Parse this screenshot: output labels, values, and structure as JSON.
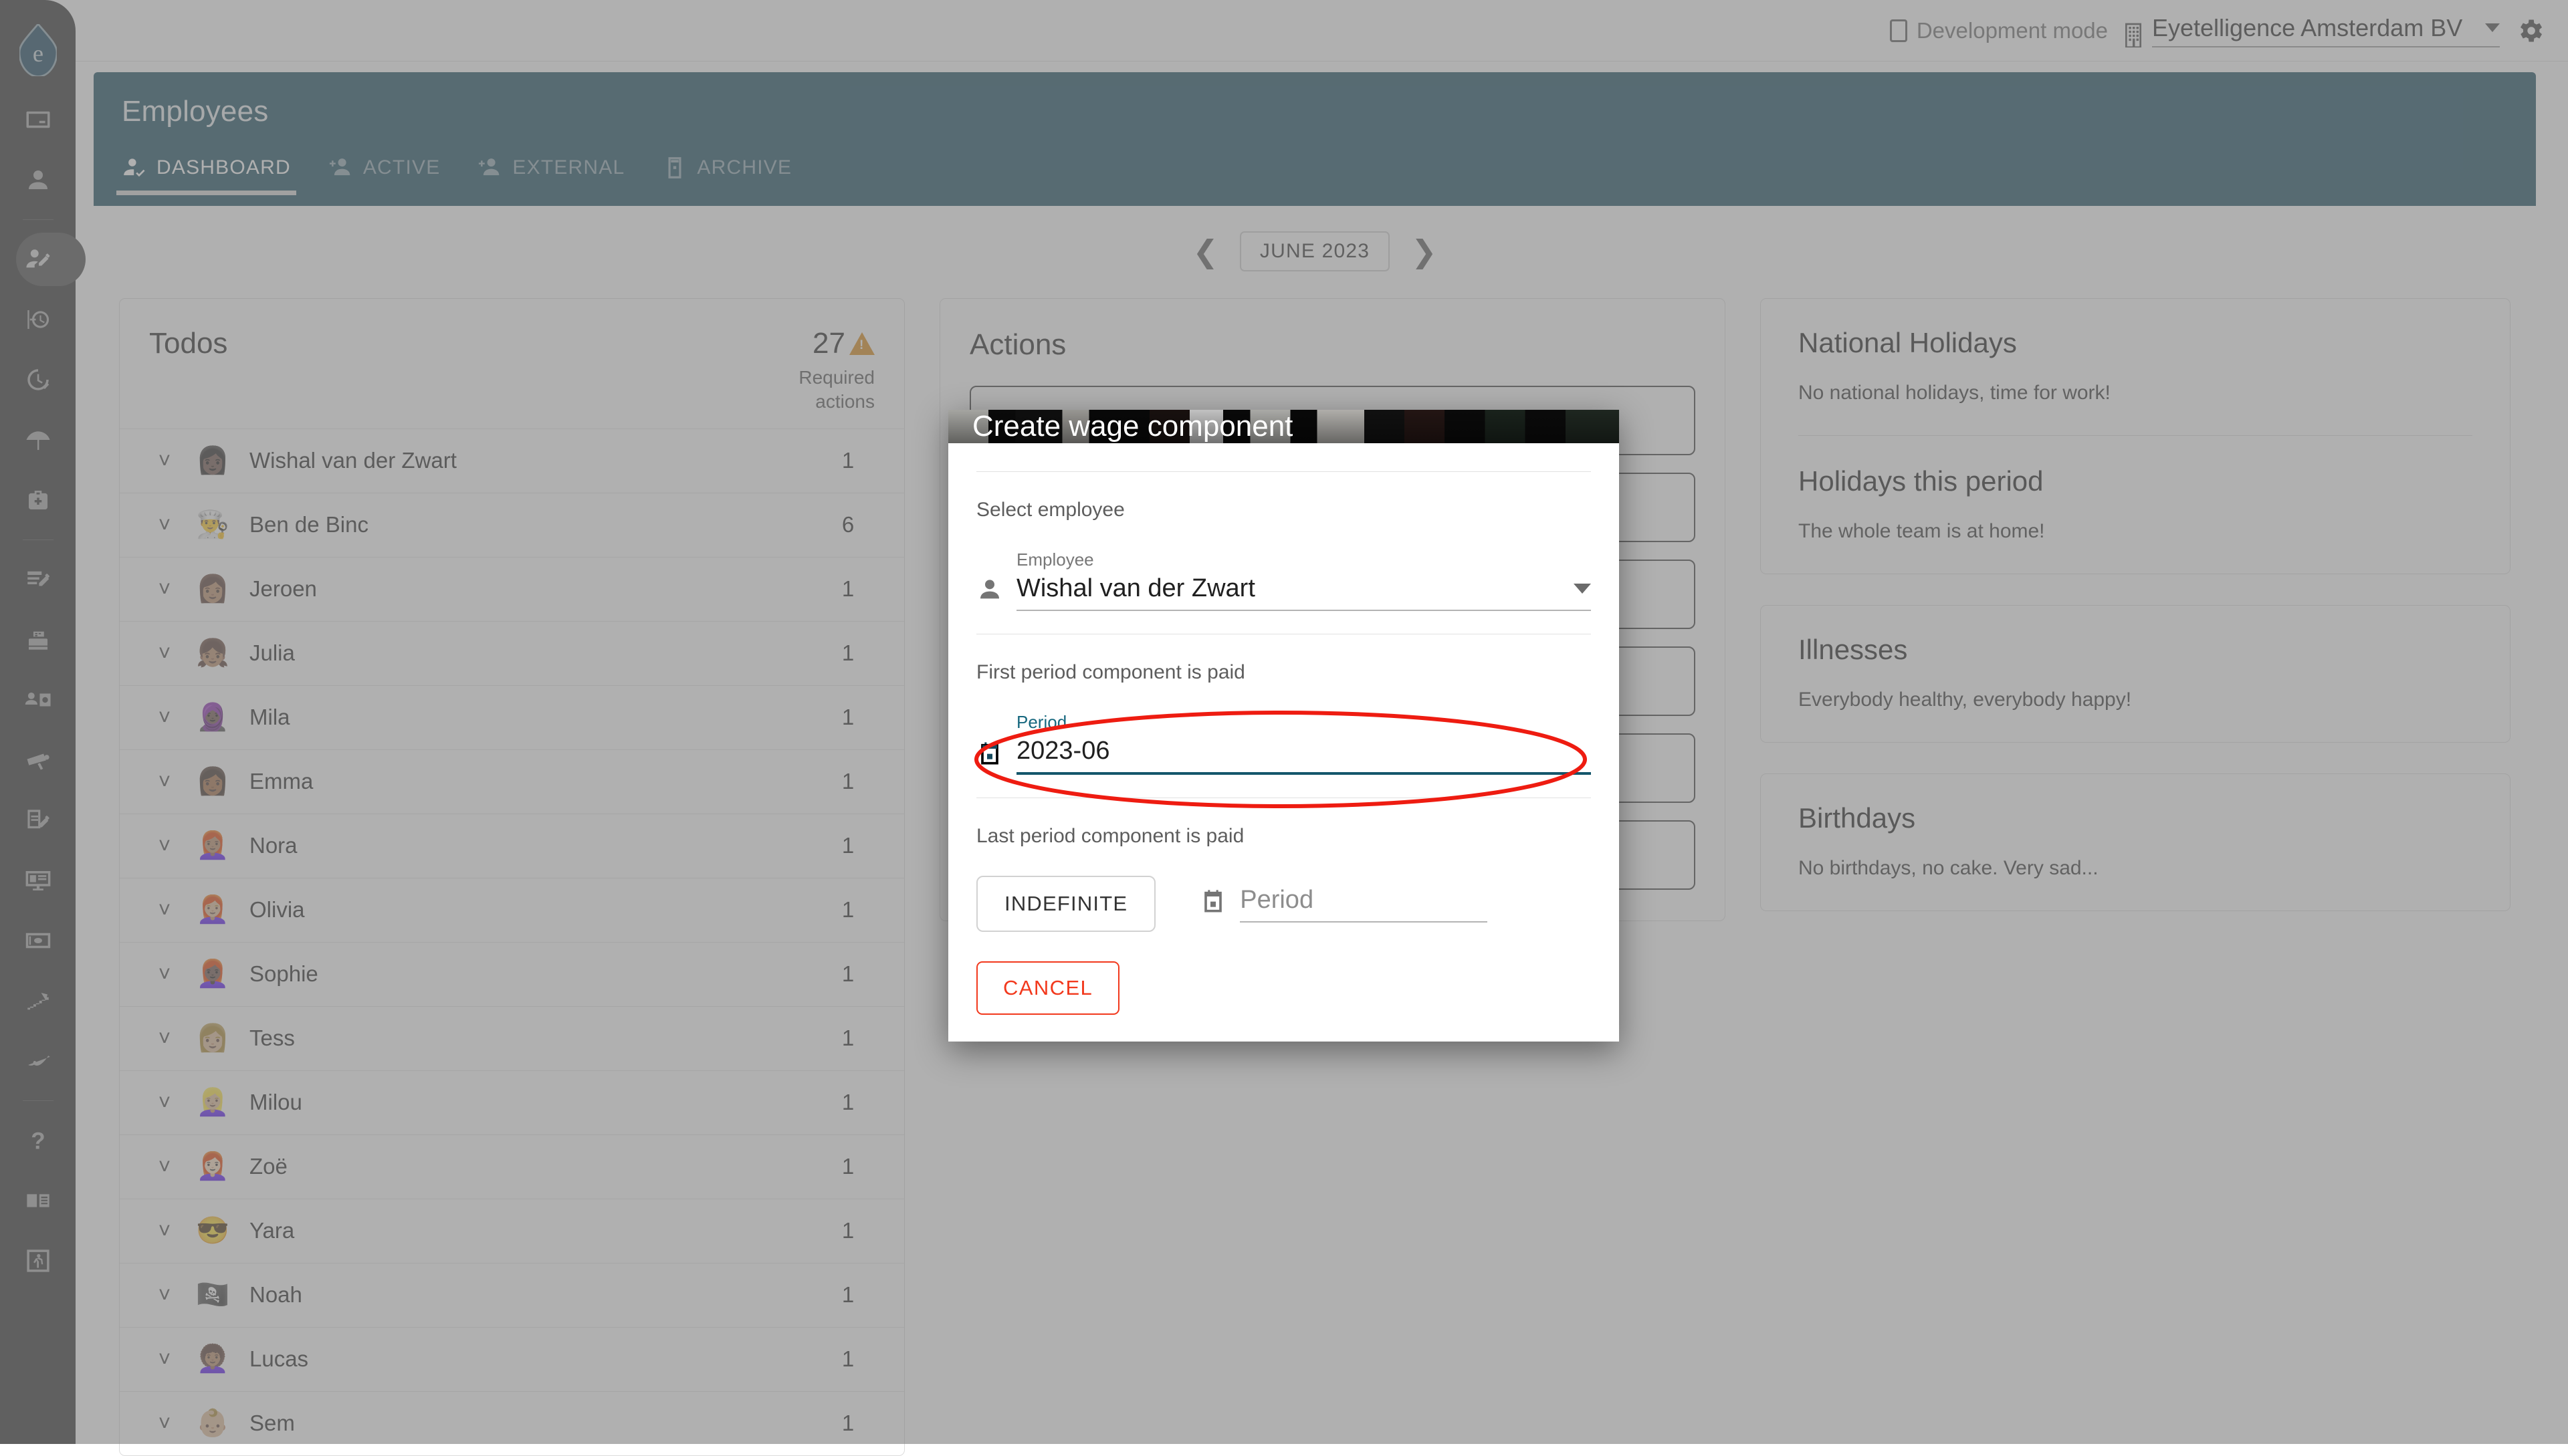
{
  "topbar": {
    "dev_mode_label": "Development mode",
    "company_name": "Eyetelligence Amsterdam BV",
    "company_icon": "building-icon",
    "gear_icon": "gear-icon",
    "caret_icon": "chevron-down-icon"
  },
  "sidebar": {
    "logo": "eyetelligence-logo",
    "items": [
      {
        "icon": "calendar-card-icon",
        "active": false
      },
      {
        "icon": "person-icon",
        "active": false
      },
      {
        "icon": "person-edit-icon",
        "active": true
      },
      {
        "icon": "clock-in-icon",
        "active": false
      },
      {
        "icon": "clock-check-icon",
        "active": false
      },
      {
        "icon": "beach-umbrella-icon",
        "active": false
      },
      {
        "icon": "medical-bag-icon",
        "active": false
      },
      {
        "icon": "document-edit-icon",
        "active": false
      },
      {
        "icon": "cash-register-icon",
        "active": false
      },
      {
        "icon": "contacts-icon",
        "active": false
      },
      {
        "icon": "security-camera-icon",
        "active": false
      },
      {
        "icon": "contract-sign-icon",
        "active": false
      },
      {
        "icon": "monitor-icon",
        "active": false
      },
      {
        "icon": "banknote-icon",
        "active": false
      },
      {
        "icon": "stairs-growth-icon",
        "active": false
      },
      {
        "icon": "signature-icon",
        "active": false
      },
      {
        "icon": "help-question-icon",
        "active": false
      },
      {
        "icon": "manual-book-icon",
        "active": false
      },
      {
        "icon": "logout-exit-icon",
        "active": false
      }
    ]
  },
  "page": {
    "title": "Employees",
    "tabs": [
      {
        "label": "DASHBOARD",
        "icon": "person-check-icon",
        "active": true
      },
      {
        "label": "ACTIVE",
        "icon": "person-add-icon",
        "active": false
      },
      {
        "label": "EXTERNAL",
        "icon": "person-add-icon",
        "active": false
      },
      {
        "label": "ARCHIVE",
        "icon": "archive-box-icon",
        "active": false
      }
    ]
  },
  "period_nav": {
    "prev_icon": "chevron-left-icon",
    "next_icon": "chevron-right-icon",
    "current": "JUNE 2023"
  },
  "todos": {
    "title": "Todos",
    "count": "27",
    "warning_icon": "warning-triangle-icon",
    "warning_color": "#d98a16",
    "column_header": "Required\nactions",
    "column_header_line1": "Required",
    "column_header_line2": "actions",
    "rows": [
      {
        "name": "Wishal van der Zwart",
        "actions": "1",
        "avatar": "👩🏿"
      },
      {
        "name": "Ben de Binc",
        "actions": "6",
        "avatar": "👨‍🍳"
      },
      {
        "name": "Jeroen",
        "actions": "1",
        "avatar": "👩🏽"
      },
      {
        "name": "Julia",
        "actions": "1",
        "avatar": "👧🏽"
      },
      {
        "name": "Mila",
        "actions": "1",
        "avatar": "🧕🏿"
      },
      {
        "name": "Emma",
        "actions": "1",
        "avatar": "👩🏾"
      },
      {
        "name": "Nora",
        "actions": "1",
        "avatar": "👩🏽‍🦰"
      },
      {
        "name": "Olivia",
        "actions": "1",
        "avatar": "👩🏼‍🦰"
      },
      {
        "name": "Sophie",
        "actions": "1",
        "avatar": "👩🏿‍🦰"
      },
      {
        "name": "Tess",
        "actions": "1",
        "avatar": "👩🏼"
      },
      {
        "name": "Milou",
        "actions": "1",
        "avatar": "👱🏼‍♀️"
      },
      {
        "name": "Zoë",
        "actions": "1",
        "avatar": "👩🏻‍🦰"
      },
      {
        "name": "Yara",
        "actions": "1",
        "avatar": "😎"
      },
      {
        "name": "Noah",
        "actions": "1",
        "avatar": "🏴‍☠️"
      },
      {
        "name": "Lucas",
        "actions": "1",
        "avatar": "👩🏽‍🦱"
      },
      {
        "name": "Sem",
        "actions": "1",
        "avatar": "👶🏼"
      }
    ]
  },
  "actions_panel": {
    "title": "Actions",
    "cards": [
      "",
      "",
      "",
      "",
      "",
      ""
    ]
  },
  "right_panel": {
    "holidays_card": {
      "national_title": "National Holidays",
      "national_text": "No national holidays, time for work!",
      "period_title": "Holidays this period",
      "period_text": "The whole team is at home!"
    },
    "illness_card": {
      "title": "Illnesses",
      "text": "Everybody healthy, everybody happy!"
    },
    "birthdays_card": {
      "title": "Birthdays",
      "text": "No birthdays, no cake. Very sad..."
    }
  },
  "modal": {
    "title": "Create wage component",
    "select_employee_label": "Select employee",
    "employee_field_label": "Employee",
    "employee_value": "Wishal van der Zwart",
    "employee_icon": "person-icon",
    "first_period_label": "First period component is paid",
    "first_period_field_label": "Period",
    "first_period_value": "2023-06",
    "first_period_icon": "calendar-icon",
    "last_period_label": "Last period component is paid",
    "indefinite_label": "INDEFINITE",
    "last_period_field_placeholder": "Period",
    "last_period_icon": "calendar-icon",
    "cancel_label": "CANCEL",
    "accent_color": "#14566b",
    "cancel_color": "#f2391d"
  },
  "annotation": {
    "shape": "ellipse",
    "color": "#ee1c11",
    "target": "first-period-field"
  }
}
